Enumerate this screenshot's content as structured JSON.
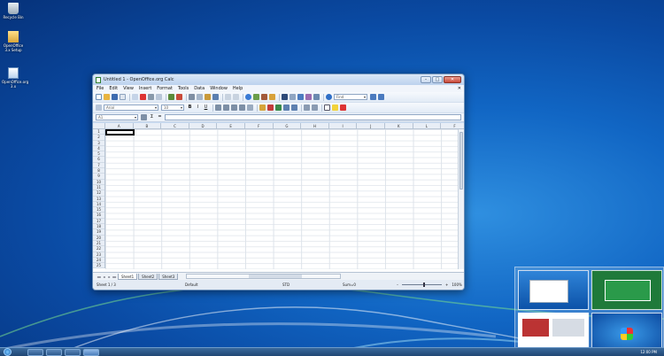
{
  "desktop": {
    "icons": [
      {
        "label": "Recycle Bin",
        "icon": "recycle-bin-icon"
      },
      {
        "label": "OpenOffice 3.x Setup",
        "icon": "folder-icon"
      },
      {
        "label": "OpenOffice.org 3.x",
        "icon": "openoffice-icon"
      }
    ]
  },
  "window": {
    "title": "Untitled 1 - OpenOffice.org Calc",
    "buttons": {
      "minimize": "–",
      "maximize": "□",
      "close": "✕"
    },
    "menu": [
      "File",
      "Edit",
      "View",
      "Insert",
      "Format",
      "Tools",
      "Data",
      "Window",
      "Help"
    ],
    "menu_close": "✕",
    "find_placeholder": "Find",
    "font_name": "Arial",
    "font_size": "10",
    "format_buttons": [
      "B",
      "I",
      "U"
    ],
    "name_box": "A1",
    "formula_icons": [
      "Σ",
      "="
    ],
    "columns": [
      "A",
      "B",
      "C",
      "D",
      "E",
      "F",
      "G",
      "H",
      "I",
      "J",
      "K",
      "L",
      "F"
    ],
    "rows": [
      "1",
      "2",
      "3",
      "4",
      "5",
      "6",
      "7",
      "8",
      "9",
      "10",
      "11",
      "12",
      "13",
      "14",
      "15",
      "16",
      "17",
      "18",
      "19",
      "20",
      "21",
      "22",
      "23",
      "24",
      "25"
    ],
    "sheet_tabs": [
      "Sheet1",
      "Sheet2",
      "Sheet3"
    ],
    "tab_nav": [
      "◂◂",
      "◂",
      "▸",
      "▸▸"
    ],
    "status": {
      "sheet": "Sheet 1 / 3",
      "style": "Default",
      "mode": "STD",
      "sum": "Sum=0",
      "zoom_minus": "–",
      "zoom_plus": "+",
      "zoom": "100%"
    }
  },
  "taskbar": {
    "clock": "12:00 PM"
  },
  "colors": {
    "desktop_blue": "#1166c4",
    "window_frame": "#c9dcf2",
    "taskbar": "#1f4674"
  }
}
